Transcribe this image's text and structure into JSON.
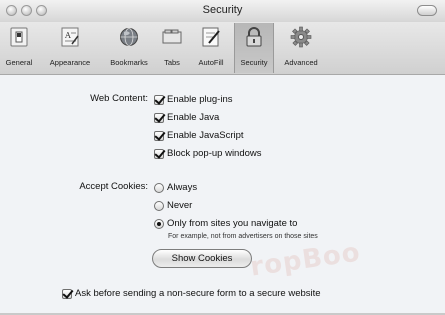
{
  "window": {
    "title": "Security"
  },
  "toolbar": {
    "items": [
      {
        "label": "General",
        "icon": "switch-icon"
      },
      {
        "label": "Appearance",
        "icon": "appearance-icon"
      },
      {
        "label": "Bookmarks",
        "icon": "globe-icon"
      },
      {
        "label": "Tabs",
        "icon": "tabs-icon"
      },
      {
        "label": "AutoFill",
        "icon": "autofill-icon"
      },
      {
        "label": "Security",
        "icon": "lock-icon",
        "selected": true
      },
      {
        "label": "Advanced",
        "icon": "gear-icon"
      }
    ]
  },
  "web_content": {
    "label": "Web Content:",
    "options": [
      {
        "label": "Enable plug-ins",
        "checked": true
      },
      {
        "label": "Enable Java",
        "checked": true
      },
      {
        "label": "Enable JavaScript",
        "checked": true
      },
      {
        "label": "Block pop-up windows",
        "checked": true
      }
    ]
  },
  "cookies": {
    "label": "Accept Cookies:",
    "options": [
      {
        "label": "Always",
        "selected": false
      },
      {
        "label": "Never",
        "selected": false
      },
      {
        "label": "Only from sites you navigate to",
        "selected": true
      }
    ],
    "hint": "For example, not from advertisers on those sites",
    "show_button": "Show Cookies"
  },
  "secure_form": {
    "label": "Ask before sending a non-secure form to a secure website",
    "checked": true
  },
  "watermark": "ropBoo"
}
